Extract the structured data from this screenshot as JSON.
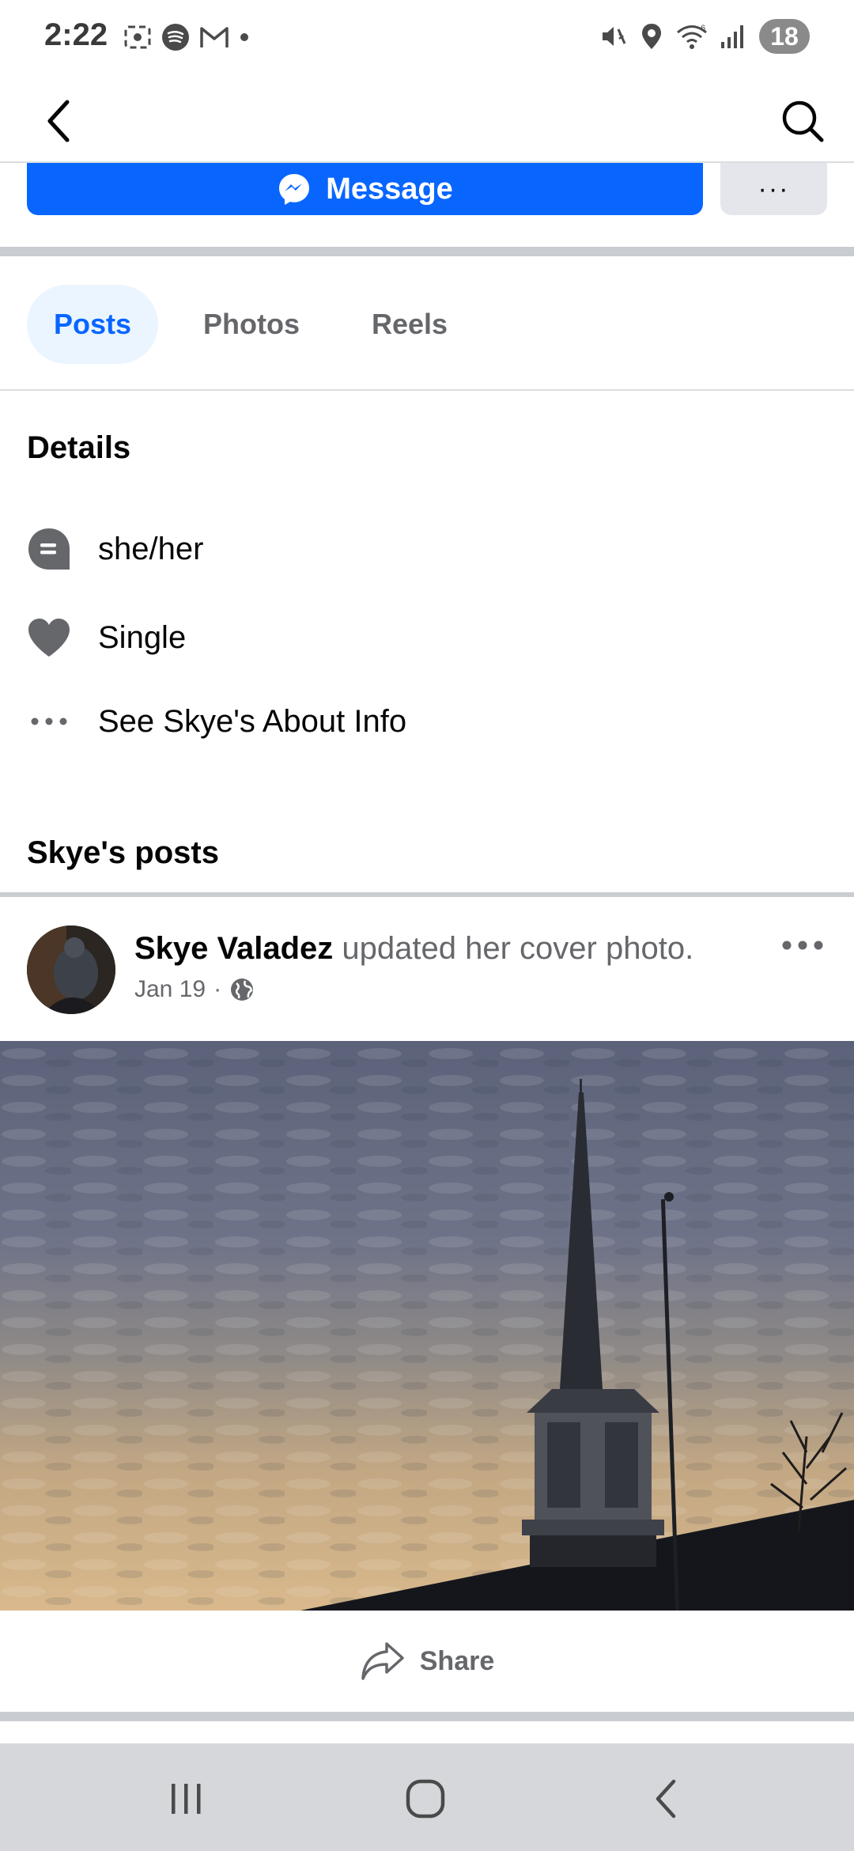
{
  "status_bar": {
    "time": "2:22",
    "battery": "18"
  },
  "profile_actions": {
    "message_label": "Message",
    "more_label": "···"
  },
  "tabs": [
    {
      "label": "Posts",
      "active": true
    },
    {
      "label": "Photos",
      "active": false
    },
    {
      "label": "Reels",
      "active": false
    }
  ],
  "details": {
    "title": "Details",
    "items": [
      {
        "icon": "pronouns-icon",
        "text": "she/her"
      },
      {
        "icon": "heart-icon",
        "text": "Single"
      },
      {
        "icon": "more-dots-icon",
        "text": "See Skye's About Info"
      }
    ]
  },
  "posts_section": {
    "title": "Skye's posts"
  },
  "post": {
    "author": "Skye Valadez",
    "action": "updated her cover photo.",
    "date": "Jan 19",
    "separator": "·",
    "audience_icon": "globe-icon",
    "share_label": "Share"
  },
  "colors": {
    "accent": "#0866ff",
    "tab_active_bg": "#ebf5ff",
    "muted_text": "#65676b",
    "divider": "#c9ccd1"
  }
}
